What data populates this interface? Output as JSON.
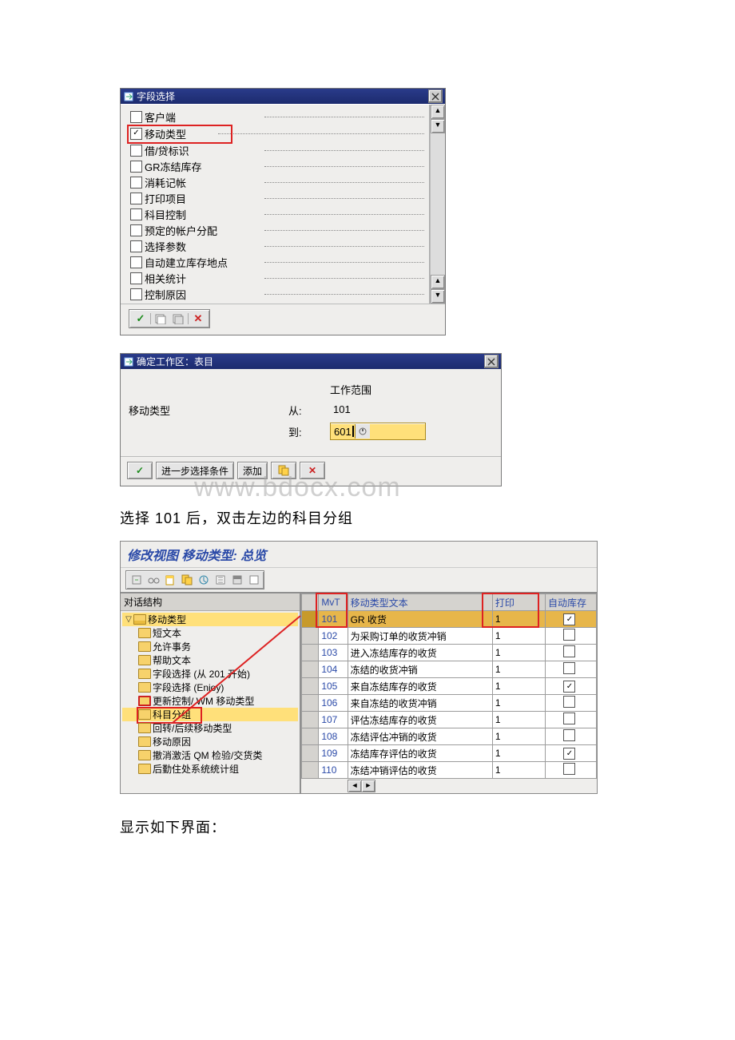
{
  "dialog1": {
    "title": "字段选择",
    "items": [
      {
        "label": "客户端",
        "checked": false
      },
      {
        "label": "移动类型",
        "checked": true,
        "highlight": true
      },
      {
        "label": "借/贷标识",
        "checked": false
      },
      {
        "label": "GR冻结库存",
        "checked": false
      },
      {
        "label": "消耗记帐",
        "checked": false
      },
      {
        "label": "打印项目",
        "checked": false
      },
      {
        "label": "科目控制",
        "checked": false
      },
      {
        "label": "预定的帐户分配",
        "checked": false
      },
      {
        "label": "选择参数",
        "checked": false
      },
      {
        "label": "自动建立库存地点",
        "checked": false
      },
      {
        "label": "相关统计",
        "checked": false
      },
      {
        "label": "控制原因",
        "checked": false
      }
    ]
  },
  "dialog2": {
    "title": "确定工作区：表目",
    "work_range_label": "工作范围",
    "field_label": "移动类型",
    "from_label": "从:",
    "to_label": "到:",
    "from_value": "101",
    "to_value": "601",
    "buttons": {
      "further": "进一步选择条件",
      "append": "添加"
    }
  },
  "watermark_text": "www.bdocx.com",
  "instr1": "选择 101 后，双击左边的科目分组",
  "instr2": "显示如下界面：",
  "view3": {
    "title": "修改视图 移动类型: 总览",
    "tree_header": "对话结构",
    "tree": [
      {
        "label": "移动类型",
        "open": true,
        "level": 0,
        "highlight": true
      },
      {
        "label": "短文本",
        "level": 1
      },
      {
        "label": "允许事务",
        "level": 1
      },
      {
        "label": "帮助文本",
        "level": 1
      },
      {
        "label": "字段选择 (从 201 开始)",
        "level": 1
      },
      {
        "label": "字段选择 (Enjoy)",
        "level": 1
      },
      {
        "label": "更新控制/ WM 移动类型",
        "level": 1,
        "red_folder": true
      },
      {
        "label": "科目分组",
        "level": 1,
        "highlight": true,
        "red_box": true
      },
      {
        "label": "回转/后续移动类型",
        "level": 1
      },
      {
        "label": "移动原因",
        "level": 1
      },
      {
        "label": "撤消激活 QM 检验/交货类",
        "level": 1
      },
      {
        "label": "后勤住处系统统计组",
        "level": 1
      }
    ],
    "columns": {
      "mvt": "MvT",
      "text": "移动类型文本",
      "print": "打印",
      "auto": "自动库存"
    },
    "rows": [
      {
        "mvt": "101",
        "text": "GR 收货",
        "print": "1",
        "auto": true,
        "selected": true
      },
      {
        "mvt": "102",
        "text": "为采购订单的收货冲销",
        "print": "1",
        "auto": false
      },
      {
        "mvt": "103",
        "text": "进入冻结库存的收货",
        "print": "1",
        "auto": false
      },
      {
        "mvt": "104",
        "text": "冻结的收货冲销",
        "print": "1",
        "auto": false
      },
      {
        "mvt": "105",
        "text": "来自冻结库存的收货",
        "print": "1",
        "auto": true
      },
      {
        "mvt": "106",
        "text": "来自冻结的收货冲销",
        "print": "1",
        "auto": false
      },
      {
        "mvt": "107",
        "text": "评估冻结库存的收货",
        "print": "1",
        "auto": false
      },
      {
        "mvt": "108",
        "text": "冻结评估冲销的收货",
        "print": "1",
        "auto": false
      },
      {
        "mvt": "109",
        "text": "冻结库存评估的收货",
        "print": "1",
        "auto": true
      },
      {
        "mvt": "110",
        "text": "冻结冲销评估的收货",
        "print": "1",
        "auto": false
      }
    ]
  }
}
